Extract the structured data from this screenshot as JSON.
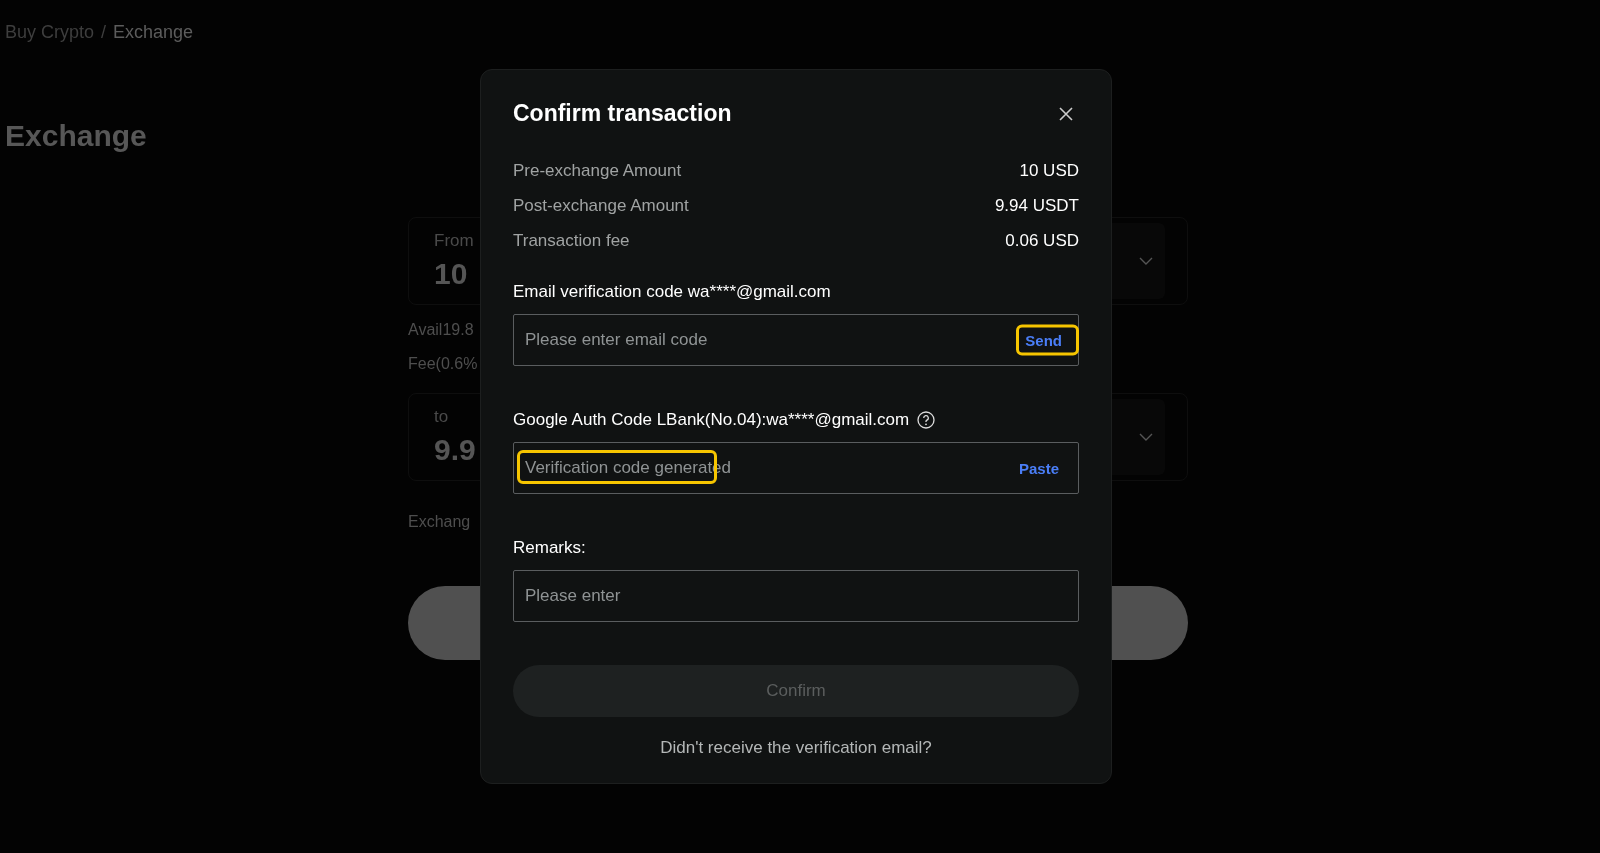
{
  "breadcrumb": [
    {
      "label": "Buy Crypto",
      "current": false
    },
    {
      "label": "Exchange",
      "current": true
    }
  ],
  "breadcrumb_separator": "/",
  "page_title": "Exchange",
  "from": {
    "label": "From",
    "amount": "10"
  },
  "avail": "Avail19.8",
  "fee": "Fee(0.6%",
  "to": {
    "label": "to",
    "amount": "9.9"
  },
  "exchange_note": "Exchang",
  "dialog": {
    "title": "Confirm transaction",
    "summary": [
      {
        "label": "Pre-exchange Amount",
        "value": "10 USD"
      },
      {
        "label": "Post-exchange Amount",
        "value": "9.94 USDT"
      },
      {
        "label": "Transaction fee",
        "value": "0.06 USD"
      }
    ],
    "fields": [
      {
        "label": "Email verification code wa****@gmail.com",
        "help": false,
        "placeholder": "Please enter email code",
        "action": "Send",
        "action_highlighted": true,
        "placeholder_highlighted": false
      },
      {
        "label": "Google Auth Code LBank(No.04):wa****@gmail.com",
        "help": true,
        "placeholder": "Verification code generated",
        "action": "Paste",
        "action_highlighted": false,
        "placeholder_highlighted": true
      },
      {
        "label": "Remarks:",
        "help": false,
        "placeholder": "Please enter",
        "placeholder_highlighted": false
      }
    ],
    "confirm_button": {
      "label": "Confirm",
      "disabled": true
    },
    "footer_link": "Didn't receive the verification email?"
  }
}
